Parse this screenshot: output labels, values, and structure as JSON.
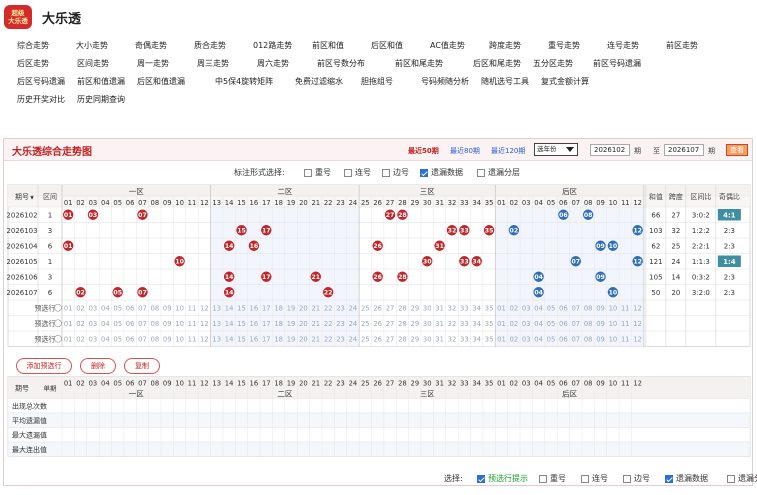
{
  "app": {
    "logo_text": "超级大乐透",
    "title": "大乐透"
  },
  "nav": {
    "row1": [
      "综合走势",
      "大小走势",
      "奇偶走势",
      "质合走势",
      "012路走势",
      "前区和值",
      "后区和值",
      "AC值走势",
      "跨度走势",
      "重号走势",
      "连号走势",
      "前区走势"
    ],
    "row2": [
      "后区走势",
      "区间走势",
      "周一走势",
      "周三走势",
      "周六走势",
      "前区号数分布",
      "前区和尾走势",
      "后区和尾走势",
      "五分区走势",
      "前区号码遗漏"
    ],
    "row3": [
      "后区号码遗漏",
      "前区和值遗漏",
      "后区和值遗漏",
      "中5保4旋转矩阵",
      "免费过滤缩水",
      "胆拖组号",
      "号码频随分析",
      "随机选号工具",
      "复式金额计算"
    ],
    "row4": [
      "历史开奖对比",
      "历史同期查询"
    ]
  },
  "panel": {
    "title": "大乐透综合走势图",
    "period_links": [
      "最近50期",
      "最近80期",
      "最近120期"
    ],
    "select_value": "选年份",
    "range_from": "2026102",
    "range_to": "2026107",
    "unit": "期",
    "sep": "至",
    "query_label": "查看",
    "options_label": "标注形式选择:",
    "options": [
      {
        "label": "重号",
        "checked": false
      },
      {
        "label": "连号",
        "checked": false
      },
      {
        "label": "边号",
        "checked": false
      },
      {
        "label": "遗漏数据",
        "checked": true
      },
      {
        "label": "遗漏分层",
        "checked": false
      }
    ],
    "header": {
      "issue": "期号",
      "sort_icon": "▼",
      "zone_col": "区间",
      "front": "一区",
      "mid": "二区",
      "third": "三区",
      "back": "后区",
      "sum": "和值",
      "span": "跨度",
      "zone_ratio": "区间比",
      "odd_even": "奇偶比",
      "nums_front": [
        "01",
        "02",
        "03",
        "04",
        "05",
        "06",
        "07",
        "08",
        "09",
        "10",
        "11",
        "12"
      ],
      "nums_mid": [
        "13",
        "14",
        "15",
        "16",
        "17",
        "18",
        "19",
        "20",
        "21",
        "22",
        "23",
        "24"
      ],
      "nums_third": [
        "25",
        "26",
        "27",
        "28",
        "29",
        "30",
        "31",
        "32",
        "33",
        "34",
        "35"
      ],
      "nums_back": [
        "01",
        "02",
        "03",
        "04",
        "05",
        "06",
        "07",
        "08",
        "09",
        "10",
        "11",
        "12"
      ]
    },
    "rows": [
      {
        "issue": "2026102",
        "zone": "1",
        "sum": "66",
        "span": "27",
        "zr": "3:0:2",
        "oe": "4:1",
        "oe_hl": true
      },
      {
        "issue": "2026103",
        "zone": "3",
        "sum": "103",
        "span": "32",
        "zr": "1:2:2",
        "oe": "2:3",
        "oe_hl": false
      },
      {
        "issue": "2026104",
        "zone": "6",
        "sum": "62",
        "span": "25",
        "zr": "2:2:1",
        "oe": "2:3",
        "oe_hl": false
      },
      {
        "issue": "2026105",
        "zone": "1",
        "sum": "121",
        "span": "24",
        "zr": "1:1:3",
        "oe": "1:4",
        "oe_hl": true
      },
      {
        "issue": "2026106",
        "zone": "3",
        "sum": "105",
        "span": "14",
        "zr": "0:3:2",
        "oe": "2:3",
        "oe_hl": false
      },
      {
        "issue": "2026107",
        "zone": "6",
        "sum": "50",
        "span": "20",
        "zr": "3:2:0",
        "oe": "2:3",
        "oe_hl": false
      }
    ],
    "pre_rows": [
      "预选行1",
      "预选行2",
      "预选行3"
    ],
    "buttons": {
      "add": "添加预选行",
      "delete": "删除",
      "copy": "复制"
    },
    "stats_header": {
      "issue": "期号",
      "sort": "单期"
    },
    "stats": [
      {
        "label": "出现总次数"
      },
      {
        "label": "平均遗漏值"
      },
      {
        "label": "最大遗漏值"
      },
      {
        "label": "最大连出值"
      }
    ],
    "bottom_label": "选择:",
    "bottom_options": [
      {
        "label": "预选行提示",
        "checked": true,
        "accent": true
      },
      {
        "label": "重号",
        "checked": false
      },
      {
        "label": "连号",
        "checked": false
      },
      {
        "label": "边号",
        "checked": false
      },
      {
        "label": "遗漏数据",
        "checked": true
      },
      {
        "label": "遗漏分层",
        "checked": false
      }
    ],
    "colors": {
      "red_ball": "#c0262a",
      "blue_ball": "#2f6fb8",
      "accent": "#c21f1f",
      "link": "#2a5bd7"
    }
  }
}
